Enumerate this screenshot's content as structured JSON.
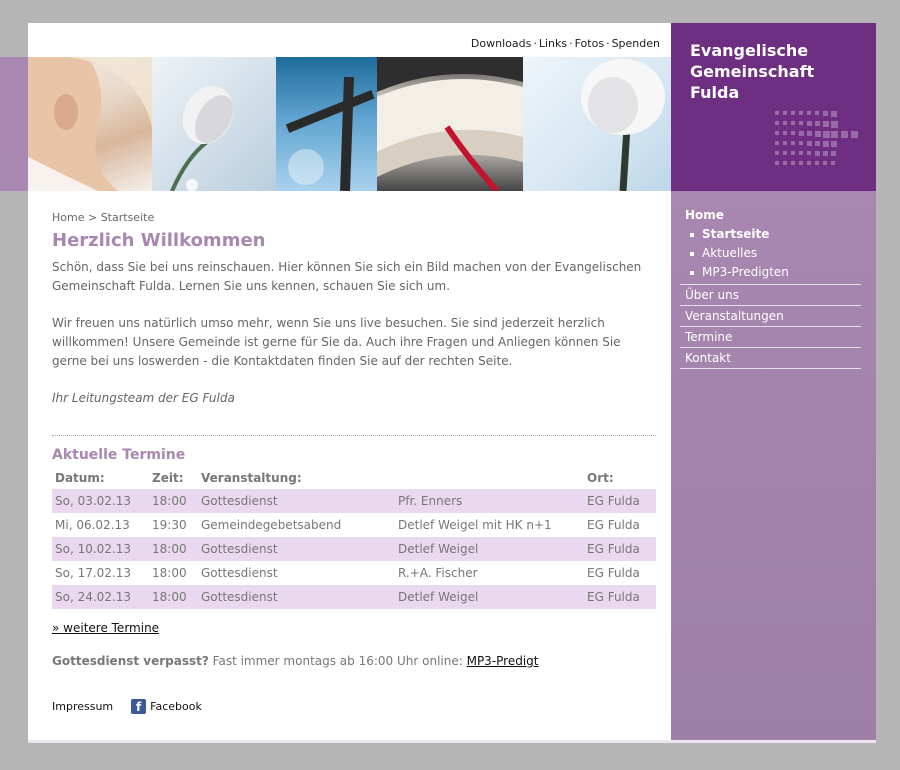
{
  "topnav": {
    "items": [
      "Downloads",
      "Links",
      "Fotos",
      "Spenden"
    ],
    "separator": "·"
  },
  "brand": {
    "line1": "Evangelische",
    "line2": "Gemeinschaft",
    "line3": "Fulda"
  },
  "breadcrumb": {
    "home": "Home",
    "sep": ">",
    "current": "Startseite"
  },
  "page": {
    "title": "Herzlich Willkommen",
    "para1": "Schön, dass Sie bei uns reinschauen. Hier können Sie sich ein Bild machen von der Evangelischen Gemeinschaft Fulda. Lernen Sie uns kennen, schauen Sie sich um.",
    "para2": "Wir freuen uns natürlich umso mehr, wenn Sie uns live besuchen. Sie sind jederzeit herzlich willkommen! Unsere Gemeinde ist gerne für Sie da. Auch ihre Fragen und Anliegen können Sie gerne bei uns loswerden - die Kontaktdaten finden Sie auf der rechten Seite.",
    "signature": "Ihr Leitungsteam der EG Fulda"
  },
  "termine": {
    "heading": "Aktuelle Termine",
    "headers": {
      "datum": "Datum:",
      "zeit": "Zeit:",
      "veranstaltung": "Veranstaltung:",
      "leitung": "",
      "ort": "Ort:"
    },
    "rows": [
      {
        "datum": "So, 03.02.13",
        "zeit": "18:00",
        "veranstaltung": "Gottesdienst",
        "leitung": "Pfr. Enners",
        "ort": "EG Fulda"
      },
      {
        "datum": "Mi, 06.02.13",
        "zeit": "19:30",
        "veranstaltung": "Gemeindegebetsabend",
        "leitung": "Detlef Weigel mit HK n+1",
        "ort": "EG Fulda"
      },
      {
        "datum": "So, 10.02.13",
        "zeit": "18:00",
        "veranstaltung": "Gottesdienst",
        "leitung": "Detlef Weigel",
        "ort": "EG Fulda"
      },
      {
        "datum": "So, 17.02.13",
        "zeit": "18:00",
        "veranstaltung": "Gottesdienst",
        "leitung": "R.+A. Fischer",
        "ort": "EG Fulda"
      },
      {
        "datum": "So, 24.02.13",
        "zeit": "18:00",
        "veranstaltung": "Gottesdienst",
        "leitung": "Detlef Weigel",
        "ort": "EG Fulda"
      }
    ],
    "more_link": "» weitere Termine"
  },
  "missed": {
    "bold": "Gottesdienst verpasst?",
    "text": " Fast immer montags ab 16:00 Uhr online: ",
    "link": "MP3-Predigt"
  },
  "footer": {
    "impressum": "Impressum",
    "facebook": "Facebook",
    "fb_letter": "f"
  },
  "sidebar": {
    "home": "Home",
    "sub": [
      "Startseite",
      "Aktuelles",
      "MP3-Predigten"
    ],
    "items": [
      "Über uns",
      "Veranstaltungen",
      "Termine",
      "Kontakt"
    ]
  },
  "colors": {
    "accent": "#a887b0",
    "brand": "#6e2e82",
    "row_alt": "#ead9ee"
  }
}
